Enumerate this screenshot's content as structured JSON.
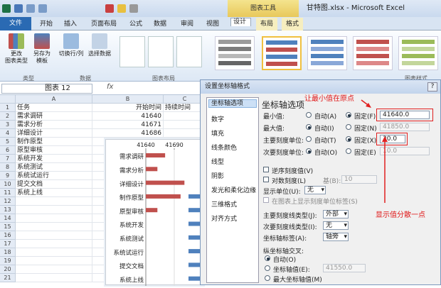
{
  "window": {
    "title": "甘特图.xlsx - Microsoft Excel",
    "context_tab_group": "图表工具"
  },
  "tabs": [
    "文件",
    "开始",
    "插入",
    "页面布局",
    "公式",
    "数据",
    "审阅",
    "视图",
    "设计",
    "布局",
    "格式"
  ],
  "ribbon": {
    "buttons": [
      {
        "label": "更改\n图表类型"
      },
      {
        "label": "另存为\n模板"
      },
      {
        "label": "切换行/列"
      },
      {
        "label": "选择数据"
      }
    ],
    "groups": [
      "类型",
      "数据",
      "图表布局",
      "图表样式"
    ]
  },
  "formula_bar": {
    "name_box": "图表 12",
    "fx": "fx"
  },
  "sheet": {
    "columns": [
      "A",
      "B",
      "C"
    ],
    "rows": [
      {
        "n": "1",
        "a": "任务",
        "b": "开始时间",
        "c": "持续时间"
      },
      {
        "n": "2",
        "a": "需求调研",
        "b": "41640",
        "c": ""
      },
      {
        "n": "3",
        "a": "需求分析",
        "b": "41671",
        "c": ""
      },
      {
        "n": "4",
        "a": "详细设计",
        "b": "41686",
        "c": ""
      },
      {
        "n": "5",
        "a": "制作原型",
        "b": "",
        "c": ""
      },
      {
        "n": "6",
        "a": "原型审核",
        "b": "",
        "c": ""
      },
      {
        "n": "7",
        "a": "系统开发",
        "b": "",
        "c": ""
      },
      {
        "n": "8",
        "a": "系统测试",
        "b": "",
        "c": ""
      },
      {
        "n": "9",
        "a": "系统试运行",
        "b": "",
        "c": ""
      },
      {
        "n": "10",
        "a": "提交文档",
        "b": "",
        "c": ""
      },
      {
        "n": "11",
        "a": "系统上线",
        "b": "",
        "c": ""
      },
      {
        "n": "12",
        "a": "",
        "b": "",
        "c": ""
      },
      {
        "n": "13",
        "a": "",
        "b": "",
        "c": ""
      },
      {
        "n": "14",
        "a": "",
        "b": "",
        "c": ""
      },
      {
        "n": "15",
        "a": "",
        "b": "",
        "c": ""
      },
      {
        "n": "16",
        "a": "",
        "b": "",
        "c": ""
      },
      {
        "n": "17",
        "a": "",
        "b": "",
        "c": ""
      },
      {
        "n": "18",
        "a": "",
        "b": "",
        "c": ""
      },
      {
        "n": "19",
        "a": "",
        "b": "",
        "c": ""
      },
      {
        "n": "20",
        "a": "",
        "b": "",
        "c": ""
      },
      {
        "n": "21",
        "a": "",
        "b": "",
        "c": ""
      }
    ]
  },
  "chart_data": {
    "type": "bar",
    "categories": [
      "需求调研",
      "需求分析",
      "详细设计",
      "制作原型",
      "原型审核",
      "系统开发",
      "系统测试",
      "系统试运行",
      "提交文档",
      "系统上线"
    ],
    "xtick_labels": [
      "41640",
      "41690"
    ],
    "series": [
      {
        "values": [
          41640,
          41640,
          41640,
          41640,
          41640,
          41640,
          41640,
          41640,
          41640,
          41640
        ],
        "color": "#4f81bd"
      },
      {
        "values": [
          41665,
          41655,
          41690,
          41685,
          41655,
          41640,
          41640,
          41640,
          41640,
          41640
        ],
        "color": "#c0504d"
      }
    ],
    "xlim": [
      41640,
      41710
    ]
  },
  "dialog": {
    "title": "设置坐标轴格式",
    "nav": [
      "坐标轴选项",
      "数字",
      "填充",
      "线条颜色",
      "线型",
      "阴影",
      "发光和柔化边缘",
      "三维格式",
      "对齐方式"
    ],
    "heading": "坐标轴选项",
    "rows": [
      {
        "label": "最小值:",
        "auto": "自动(A)",
        "fixed": "固定(F)",
        "value": "41640.0"
      },
      {
        "label": "最大值:",
        "auto": "自动(I)",
        "fixed": "固定(N)",
        "value": "41850.0"
      },
      {
        "label": "主要刻度单位:",
        "auto": "自动(T)",
        "fixed": "固定(X)",
        "value": "30.0"
      },
      {
        "label": "次要刻度单位:",
        "auto": "自动(O)",
        "fixed": "固定(E)",
        "value": "10.0"
      }
    ],
    "reverse": "逆序刻度值(V)",
    "log": "对数刻度(L)",
    "base": "基(B):",
    "base_val": "10",
    "display_unit": "显示单位(U):",
    "display_unit_val": "无",
    "show_unit": "在图表上显示刻度单位标签(S)",
    "major_tick": "主要刻度线类型(J):",
    "major_tick_val": "外部",
    "minor_tick": "次要刻度线类型(I):",
    "minor_tick_val": "无",
    "tick_label": "坐标轴标签(A):",
    "tick_label_val": "轴旁",
    "cross_title": "纵坐标轴交叉:",
    "cross": [
      {
        "label": "自动(O)"
      },
      {
        "label": "坐标轴值(E):",
        "value": "41550.0"
      },
      {
        "label": "最大坐标轴值(M)"
      }
    ]
  },
  "annotations": {
    "top": "让最小值在原点",
    "right": "显示值分散一点"
  }
}
